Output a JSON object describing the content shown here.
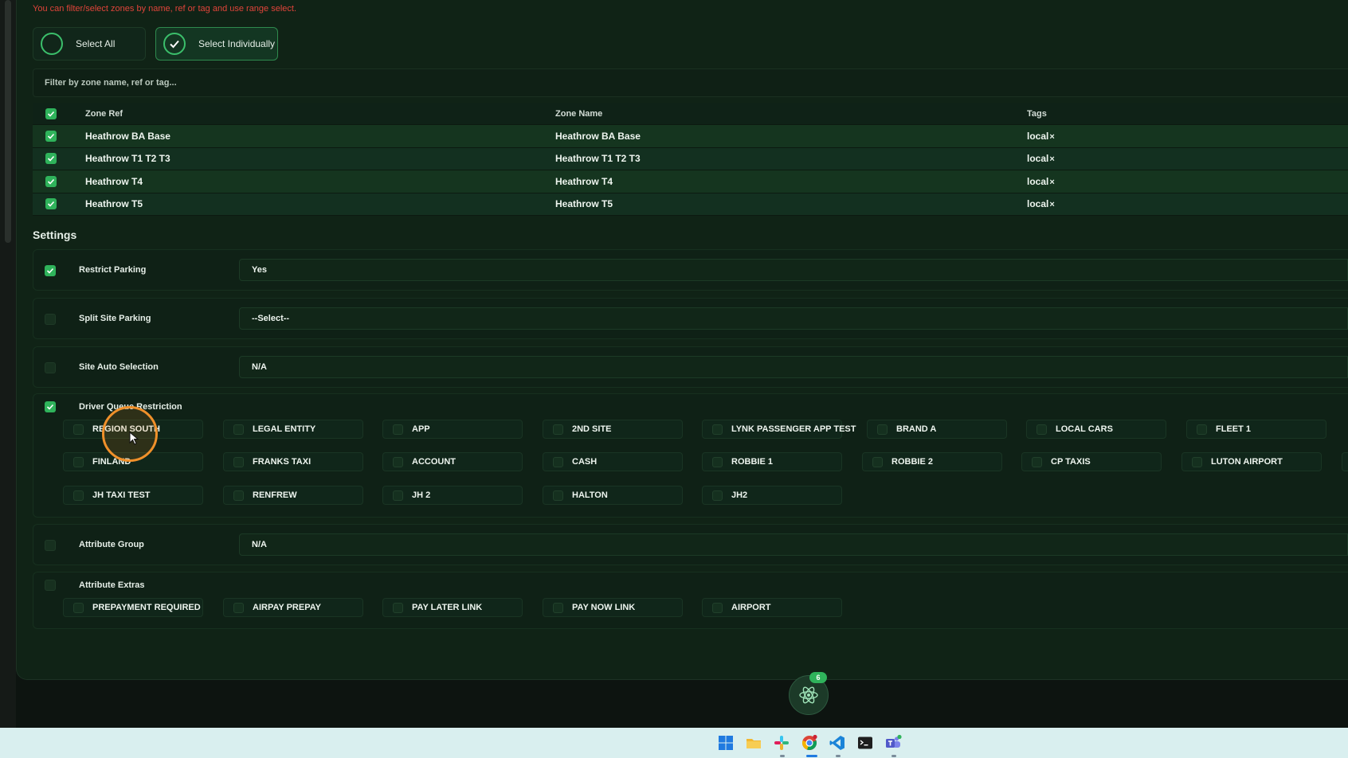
{
  "hint": "You can filter/select zones by name, ref or tag and use range select.",
  "selection": {
    "select_all": "Select All",
    "select_individually": "Select Individually"
  },
  "filter": {
    "placeholder": "Filter by zone name, ref or tag..."
  },
  "zones": {
    "headers": [
      "Zone Ref",
      "Zone Name",
      "Tags"
    ],
    "rows": [
      {
        "ref": "Heathrow BA Base",
        "name": "Heathrow BA Base",
        "tag": "local"
      },
      {
        "ref": "Heathrow T1 T2 T3",
        "name": "Heathrow T1 T2 T3",
        "tag": "local"
      },
      {
        "ref": "Heathrow T4",
        "name": "Heathrow T4",
        "tag": "local"
      },
      {
        "ref": "Heathrow T5",
        "name": "Heathrow T5",
        "tag": "local"
      }
    ],
    "tag_remove": "×"
  },
  "settings": {
    "title": "Settings",
    "restrict_parking": {
      "label": "Restrict Parking",
      "value": "Yes"
    },
    "split_site_parking": {
      "label": "Split Site Parking",
      "value": "--Select--"
    },
    "site_auto_selection": {
      "label": "Site Auto Selection",
      "value": "N/A"
    },
    "driver_queue_restriction": {
      "label": "Driver Queue Restriction",
      "options": [
        "REGION SOUTH",
        "LEGAL ENTITY",
        "APP",
        "2ND SITE",
        "LYNK PASSENGER APP TEST",
        "BRAND A",
        "LOCAL CARS",
        "FLEET 1",
        "FINLAND",
        "FRANKS TAXI",
        "ACCOUNT",
        "CASH",
        "ROBBIE 1",
        "ROBBIE 2",
        "CP TAXIS",
        "LUTON AIRPORT",
        "JH TAXI TEST",
        "RENFREW",
        "JH 2",
        "HALTON",
        "JH2"
      ]
    },
    "attribute_group": {
      "label": "Attribute Group",
      "value": "N/A"
    },
    "attribute_extras": {
      "label": "Attribute Extras",
      "options": [
        "PREPAYMENT REQUIRED",
        "AIRPAY PREPAY",
        "PAY LATER LINK",
        "PAY NOW LINK",
        "AIRPORT"
      ]
    }
  },
  "fab": {
    "badge": "6",
    "icon": "atom-icon"
  },
  "taskbar": {
    "icons": [
      "windows-start-icon",
      "file-explorer-icon",
      "slack-icon",
      "chrome-icon",
      "vscode-icon",
      "terminal-icon",
      "teams-icon"
    ]
  },
  "colors": {
    "accent": "#2fb35b",
    "panel": "#102316",
    "hint": "#e0443a",
    "cursor": "#f0902a"
  }
}
